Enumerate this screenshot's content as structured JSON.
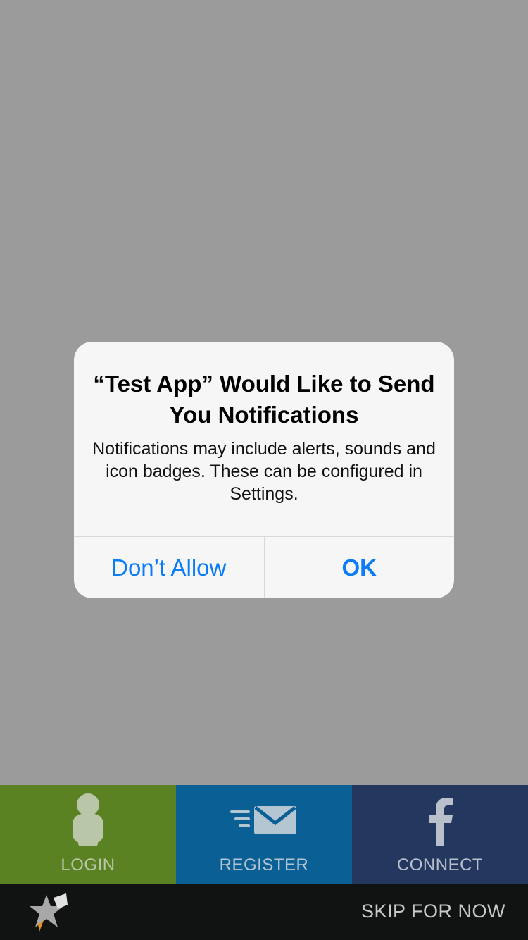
{
  "alert": {
    "title": "“Test App” Would Like to Send You Notifications",
    "message": "Notifications may include alerts, sounds and icon badges. These can be configured in Settings.",
    "deny_label": "Don’t Allow",
    "ok_label": "OK"
  },
  "tabs": [
    {
      "label": "LOGIN",
      "icon": "person-icon",
      "bg": "#5a8222",
      "fg": "#b9c6a8"
    },
    {
      "label": "REGISTER",
      "icon": "mail-icon",
      "bg": "#0a5f95",
      "fg": "#b5c6d3"
    },
    {
      "label": "CONNECT",
      "icon": "facebook-icon",
      "bg": "#24375f",
      "fg": "#b9bfcb"
    }
  ],
  "footer": {
    "logo_icon": "star-logo",
    "skip_label": "SKIP FOR NOW"
  },
  "colors": {
    "background": "#9b9b9b",
    "alert_button": "#0a7cf6",
    "footer_bg": "#111312"
  }
}
